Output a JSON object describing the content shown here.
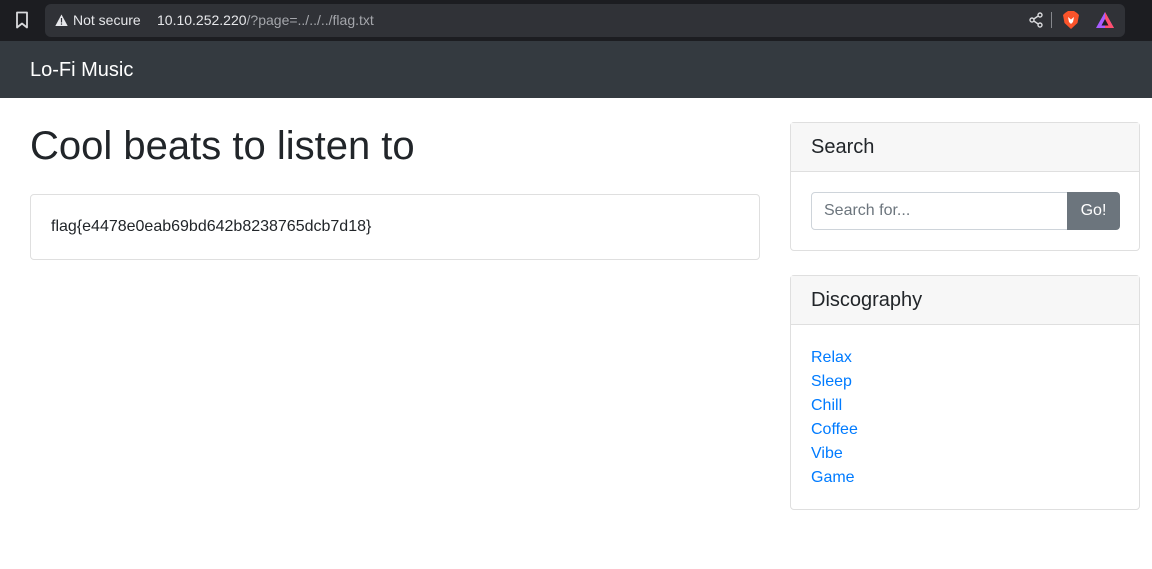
{
  "browser": {
    "security_label": "Not secure",
    "url_host": "10.10.252.220",
    "url_path": "/?page=../../../flag.txt",
    "icons": [
      "bookmark-icon",
      "warning-icon",
      "share-icon",
      "brave-shields-icon",
      "brave-rewards-icon"
    ]
  },
  "navbar": {
    "brand": "Lo-Fi Music"
  },
  "main": {
    "title": "Cool beats to listen to",
    "content": "flag{e4478e0eab69bd642b8238765dcb7d18}"
  },
  "sidebar": {
    "search": {
      "header": "Search",
      "placeholder": "Search for...",
      "button": "Go!"
    },
    "discography": {
      "header": "Discography",
      "items": [
        "Relax",
        "Sleep",
        "Chill",
        "Coffee",
        "Vibe",
        "Game"
      ]
    }
  },
  "colors": {
    "navbar_bg": "#343a40",
    "link": "#007bff",
    "button_bg": "#6c757d",
    "browser_bg": "#1c1d21"
  }
}
